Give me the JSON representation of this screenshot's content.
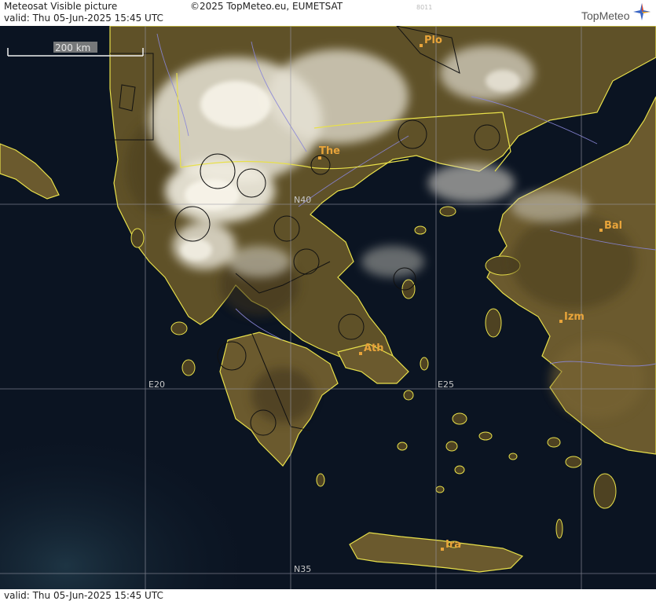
{
  "header": {
    "title": "Meteosat Visible picture",
    "copyright": "©2025 TopMeteo.eu, EUMETSAT",
    "code": "8011",
    "valid": "valid:  Thu  05-Jun-2025  15:45 UTC",
    "logo": "TopMeteo"
  },
  "footer": {
    "valid": "valid:  Thu  05-Jun-2025  15:45 UTC"
  },
  "map": {
    "scale_label": "200 km",
    "grid_labels": {
      "lat_n40": "N40",
      "lat_n35": "N35",
      "lon_e20": "E20",
      "lon_e25": "E25"
    },
    "cities": {
      "plovdiv": "Plo",
      "thessaloniki": "The",
      "balikesir": "Bal",
      "izmir": "Izm",
      "athens": "Ath",
      "iraklion": "Ira"
    },
    "colors": {
      "sea": "#0b1422",
      "land": "#6b5a2e",
      "coast": "#e8e04a",
      "border": "#e8e04a",
      "rivers": "#8a86d8",
      "city": "#e8a43a",
      "grid": "#9a9aa8"
    }
  }
}
